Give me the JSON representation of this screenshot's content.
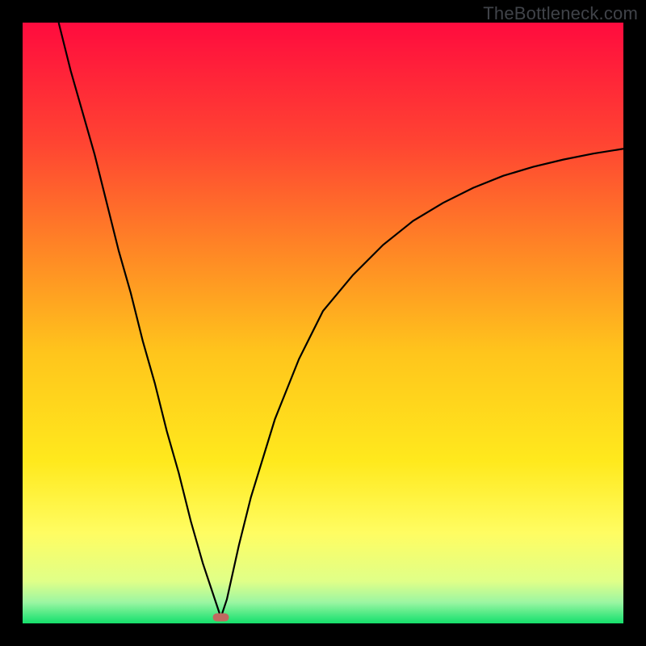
{
  "attribution": "TheBottleneck.com",
  "chart_data": {
    "type": "line",
    "title": "",
    "xlabel": "",
    "ylabel": "",
    "xlim": [
      0,
      100
    ],
    "ylim": [
      0,
      100
    ],
    "background": {
      "type": "vertical-gradient",
      "stops": [
        {
          "pos": 0.0,
          "color": "#ff0b3e"
        },
        {
          "pos": 0.2,
          "color": "#ff4432"
        },
        {
          "pos": 0.4,
          "color": "#ff8e24"
        },
        {
          "pos": 0.55,
          "color": "#ffc51c"
        },
        {
          "pos": 0.73,
          "color": "#ffe91d"
        },
        {
          "pos": 0.85,
          "color": "#fffd62"
        },
        {
          "pos": 0.93,
          "color": "#e0ff88"
        },
        {
          "pos": 0.965,
          "color": "#9bf6a2"
        },
        {
          "pos": 0.99,
          "color": "#39e67c"
        },
        {
          "pos": 1.0,
          "color": "#16df6b"
        }
      ]
    },
    "series": [
      {
        "name": "curve",
        "color": "#000000",
        "x": [
          6,
          8,
          10,
          12,
          14,
          16,
          18,
          20,
          22,
          24,
          26,
          28,
          30,
          32,
          33,
          34,
          36,
          38,
          42,
          46,
          50,
          55,
          60,
          65,
          70,
          75,
          80,
          85,
          90,
          95,
          100
        ],
        "y": [
          100,
          92,
          85,
          78,
          70,
          62,
          55,
          47,
          40,
          32,
          25,
          17,
          10,
          4,
          1,
          4,
          13,
          21,
          34,
          44,
          52,
          58,
          63,
          67,
          70,
          72.5,
          74.5,
          76,
          77.2,
          78.2,
          79
        ]
      }
    ],
    "marker": {
      "name": "bottleneck-point",
      "x": 33,
      "y": 1,
      "color": "#c06a60"
    }
  }
}
